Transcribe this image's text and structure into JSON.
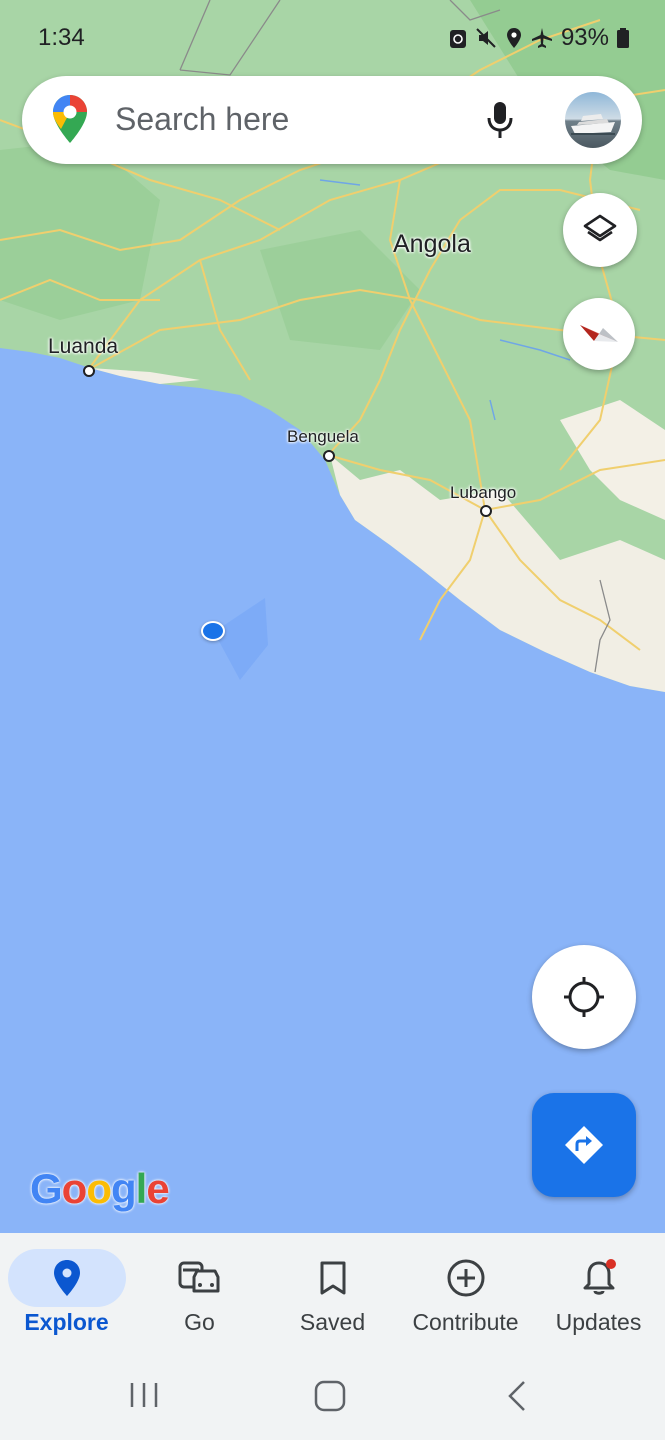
{
  "status_bar": {
    "time": "1:34",
    "battery": "93%",
    "icons": [
      "recycle-notification-icon",
      "mute-icon",
      "location-icon",
      "airplane-icon",
      "battery-icon"
    ]
  },
  "search": {
    "placeholder": "Search here"
  },
  "map": {
    "labels": {
      "country": "Angola",
      "city1": "Luanda",
      "city2": "Benguela",
      "city3": "Lubango"
    },
    "colors": {
      "water": "#8ab4f8",
      "land": "#a8d5a6",
      "dry_land": "#f1eee4",
      "roads": "#f0cf6e"
    }
  },
  "attribution": "Google",
  "bottom_nav": {
    "explore": "Explore",
    "go": "Go",
    "saved": "Saved",
    "contribute": "Contribute",
    "updates": "Updates"
  },
  "colors": {
    "accent": "#1a73e8",
    "active_pill": "#d3e3fd",
    "notification": "#d93025"
  }
}
